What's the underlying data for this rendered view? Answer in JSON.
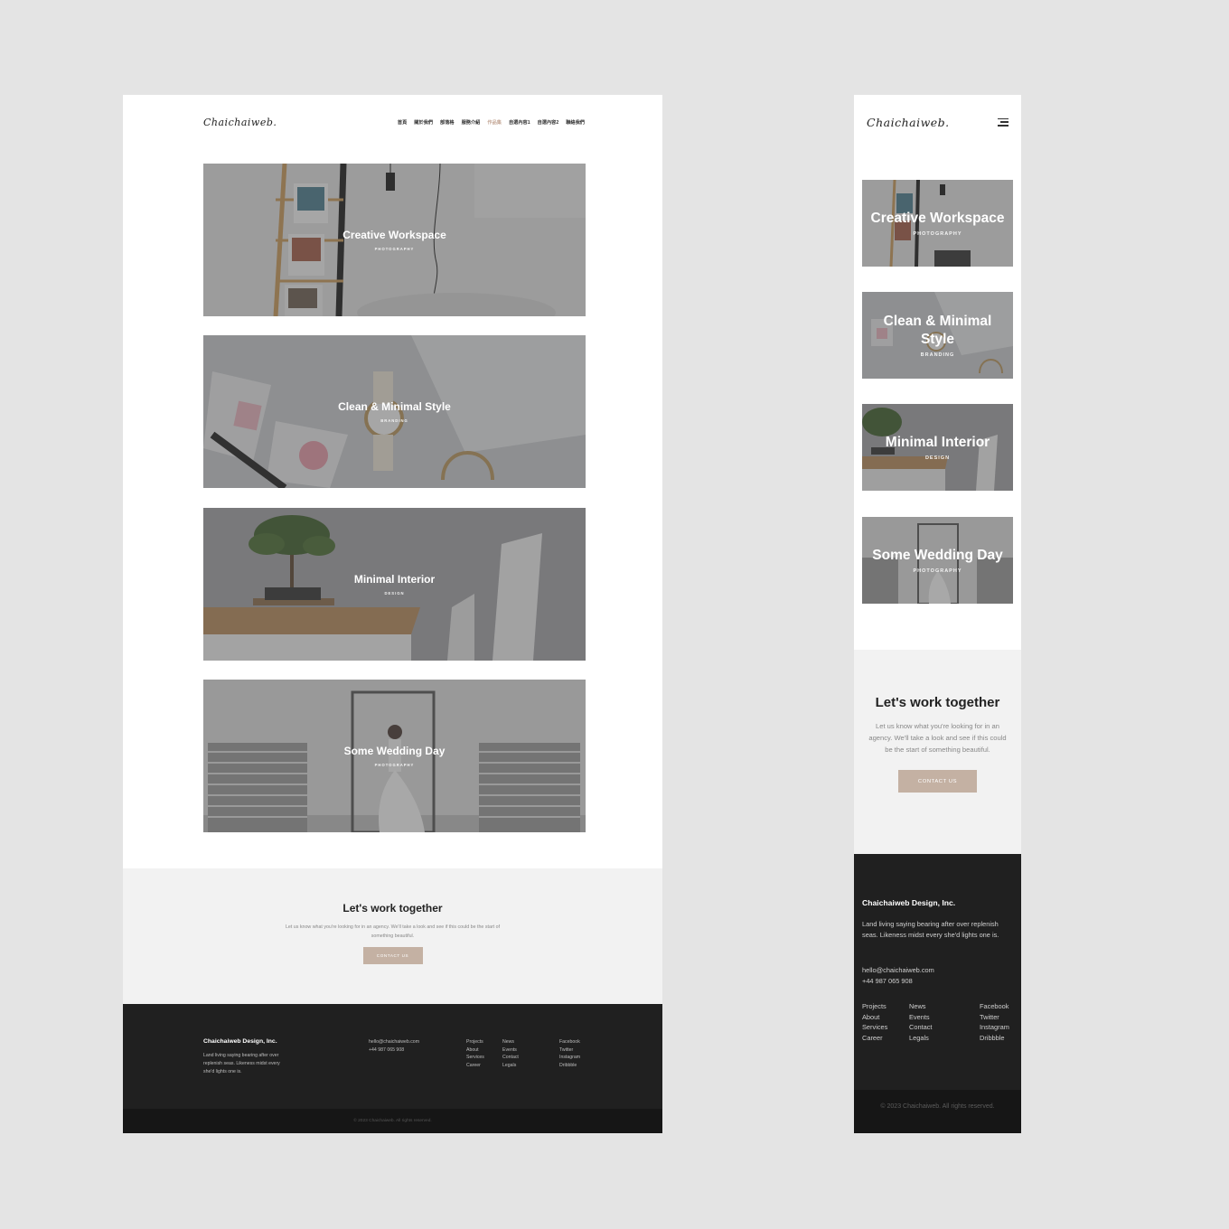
{
  "brand": {
    "logo": "Chaichaiweb.",
    "accent": "#c4b1a3",
    "nav_active": "#c4a796"
  },
  "nav": {
    "items": [
      {
        "label": "首頁",
        "active": false
      },
      {
        "label": "關於我們",
        "active": false
      },
      {
        "label": "部落格",
        "active": false
      },
      {
        "label": "服務介紹",
        "active": false
      },
      {
        "label": "作品集",
        "active": true
      },
      {
        "label": "自選內容1",
        "active": false
      },
      {
        "label": "自選內容2",
        "active": false
      },
      {
        "label": "聯絡我們",
        "active": false
      }
    ]
  },
  "projects": [
    {
      "title": "Creative Workspace",
      "category": "PHOTOGRAPHY"
    },
    {
      "title": "Clean & Minimal Style",
      "category": "BRANDING"
    },
    {
      "title": "Minimal Interior",
      "category": "DESIGN"
    },
    {
      "title": "Some Wedding Day",
      "category": "PHOTOGRAPHY"
    }
  ],
  "cta": {
    "title": "Let's work together",
    "text": "Let us know what you're looking for in an agency. We'll take a look and see if this could be the start of something beautiful.",
    "button": "CONTACT US"
  },
  "footer": {
    "company": "Chaichaiweb Design, Inc.",
    "description": "Land living saying bearing after over replenish seas. Likeness midst every she'd lights one is.",
    "email": "hello@chaichaiweb.com",
    "phone": "+44 987 065 908",
    "col1": [
      "Projects",
      "About",
      "Services",
      "Career"
    ],
    "col2": [
      "News",
      "Events",
      "Contact",
      "Legals"
    ],
    "col3": [
      "Facebook",
      "Twitter",
      "Instagram",
      "Dribbble"
    ],
    "copyright": "© 2023 Chaichaiweb. All rights reserved."
  },
  "icons": {
    "menu": "hamburger-icon"
  }
}
